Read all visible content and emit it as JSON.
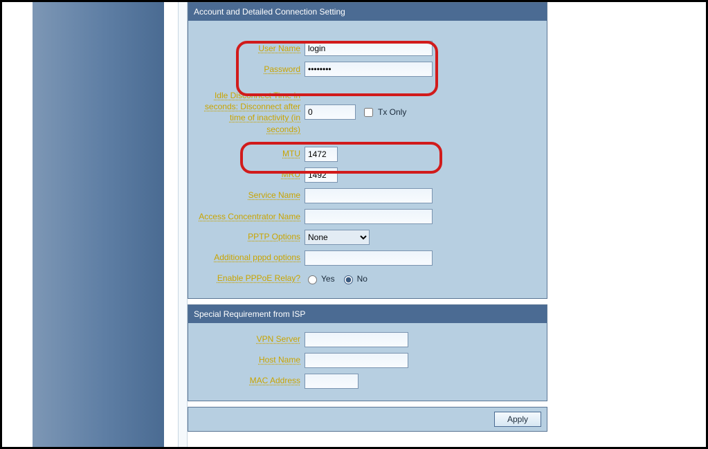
{
  "sections": {
    "account": {
      "title": "Account and Detailed Connection Setting",
      "username_label": "User Name",
      "username_value": "login",
      "password_label": "Password",
      "password_value": "••••••••",
      "idle_label": "Idle Disconnect Time in seconds: Disconnect after time of inactivity (in seconds)",
      "idle_value": "0",
      "txonly_label": "Tx Only",
      "mtu_label": "MTU",
      "mtu_value": "1472",
      "mru_label": "MRU",
      "mru_value": "1492",
      "service_label": "Service Name",
      "service_value": "",
      "ac_label": "Access Concentrator Name",
      "ac_value": "",
      "pptp_label": "PPTP Options",
      "pptp_value": "None",
      "pppd_label": "Additional pppd options",
      "pppd_value": "",
      "relay_label": "Enable PPPoE Relay?",
      "yes_label": "Yes",
      "no_label": "No"
    },
    "isp": {
      "title": "Special Requirement from ISP",
      "vpn_label": "VPN Server",
      "vpn_value": "",
      "host_label": "Host Name",
      "host_value": "",
      "mac_label": "MAC Address",
      "mac_value": ""
    }
  },
  "apply_label": "Apply"
}
